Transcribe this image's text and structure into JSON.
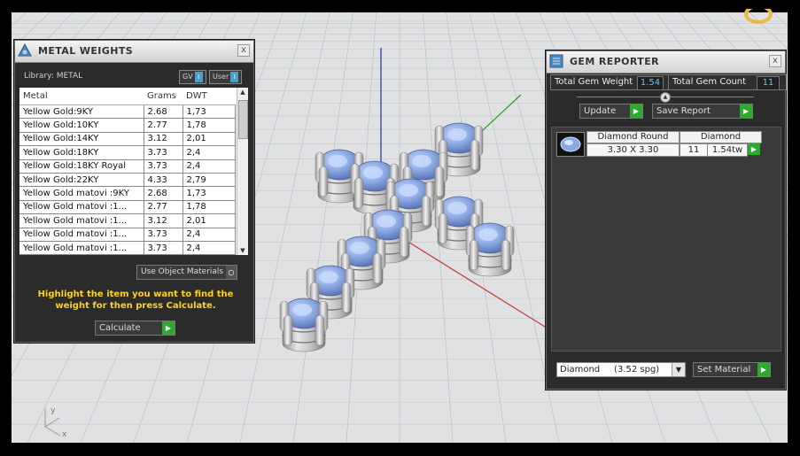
{
  "metal_weights": {
    "title": "METAL WEIGHTS",
    "library_label": "Library: METAL",
    "toggle_gv": "GV",
    "toggle_user": "User",
    "columns": [
      "Metal",
      "Grams",
      "DWT"
    ],
    "rows": [
      [
        "Yellow Gold:9KY",
        "2.68",
        "1,73"
      ],
      [
        "Yellow Gold:10KY",
        "2.77",
        "1,78"
      ],
      [
        "Yellow Gold:14KY",
        "3.12",
        "2,01"
      ],
      [
        "Yellow Gold:18KY",
        "3.73",
        "2,4"
      ],
      [
        "Yellow Gold:18KY Royal",
        "3.73",
        "2,4"
      ],
      [
        "Yellow Gold:22KY",
        "4.33",
        "2,79"
      ],
      [
        "Yellow Gold matovi :9KY",
        "2.68",
        "1,73"
      ],
      [
        "Yellow Gold matovi :1...",
        "2.77",
        "1,78"
      ],
      [
        "Yellow Gold matovi :1...",
        "3.12",
        "2,01"
      ],
      [
        "Yellow Gold matovi :1...",
        "3.73",
        "2,4"
      ],
      [
        "Yellow Gold matovi :1...",
        "3.73",
        "2,4"
      ]
    ],
    "use_object_materials": "Use Object Materials",
    "hint": "Highlight the item you want to find the weight for then press Calculate.",
    "calculate": "Calculate",
    "close": "x"
  },
  "gem_reporter": {
    "title": "GEM REPORTER",
    "total_weight_label": "Total Gem Weight",
    "total_weight_value": "1.54",
    "total_count_label": "Total Gem Count",
    "total_count_value": "11",
    "update": "Update",
    "save_report": "Save Report",
    "gem": {
      "shape": "Diamond Round",
      "material": "Diamond",
      "size": "3.30 X 3.30",
      "count": "11",
      "weight": "1.54tw"
    },
    "material_select": "Diamond     (3.52 spg)",
    "set_material": "Set Material",
    "close": "x"
  },
  "axis": {
    "x": "x",
    "y": "y"
  },
  "colors": {
    "panel_bg": "#2b2b2b",
    "accent_green": "#2eaa2e",
    "value_blue": "#5ec8ff",
    "hint_yellow": "#ffd21a"
  }
}
